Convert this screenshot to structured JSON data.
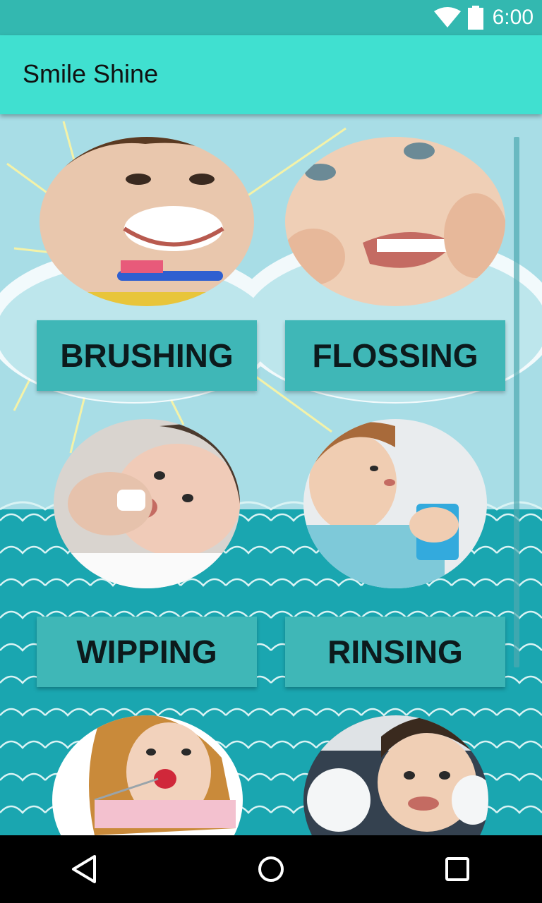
{
  "status_bar": {
    "time": "6:00",
    "icons": [
      "wifi-icon",
      "battery-icon"
    ]
  },
  "app_bar": {
    "title": "Smile Shine",
    "color": "#40e0d0"
  },
  "colors": {
    "status_bar": "#33b8b0",
    "content_bg": "#a8dde6",
    "sea": "#1aa6b0",
    "button": "#3fb7b7",
    "button_text": "#0c1a1c"
  },
  "activities": [
    {
      "label": "BRUSHING",
      "photo": "child brushing teeth"
    },
    {
      "label": "FLOSSING",
      "photo": "child flossing teeth"
    },
    {
      "label": "WIPPING",
      "photo": "baby gums being wiped"
    },
    {
      "label": "RINSING",
      "photo": "child rinsing mouth"
    },
    {
      "label": "",
      "photo": "girl eating strawberry"
    },
    {
      "label": "",
      "photo": "boy at dentist"
    }
  ],
  "nav_bar": {
    "buttons": [
      "back-icon",
      "home-icon",
      "recents-icon"
    ]
  }
}
